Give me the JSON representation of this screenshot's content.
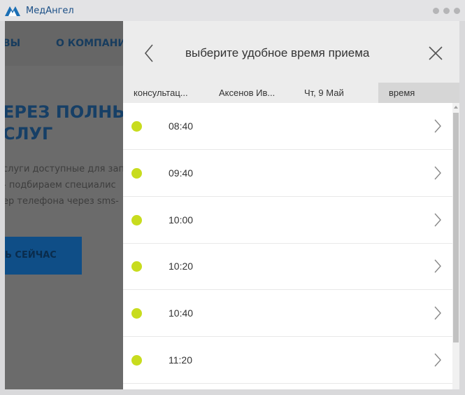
{
  "window": {
    "app_title": "МедАнгел",
    "icons": {
      "logo": "medangel-logo-icon",
      "controls": [
        "window-dot-icon",
        "window-dot-icon",
        "window-dot-icon"
      ]
    }
  },
  "site": {
    "nav": [
      "ВЫ",
      "О КОМПАНИИ"
    ],
    "hero_title_lines": [
      "ЕРЕЗ ПОЛНЫ",
      "СЛУГ"
    ],
    "hero_text_lines": [
      "слуги доступные для зап",
      "- подбираем специалис",
      "ер телефона через sms-"
    ],
    "cta_label": "Ь СЕЙЧАС"
  },
  "panel": {
    "title": "выберите удобное время приема",
    "icons": {
      "back": "chevron-left-icon",
      "close": "close-icon",
      "slot_arrow": "chevron-right-icon",
      "slot_status": "available-dot-icon"
    },
    "steps": [
      "консультац...",
      "Аксенов Ив...",
      "Чт, 9 Май",
      "время"
    ],
    "active_step": "время",
    "slots": [
      {
        "time": "08:40"
      },
      {
        "time": "09:40"
      },
      {
        "time": "10:00"
      },
      {
        "time": "10:20"
      },
      {
        "time": "10:40"
      },
      {
        "time": "11:20"
      }
    ]
  },
  "colors": {
    "accent_blue": "#1b4f86",
    "available_dot": "#c8dc1e",
    "overlay_dim": "#6b6b6b"
  }
}
